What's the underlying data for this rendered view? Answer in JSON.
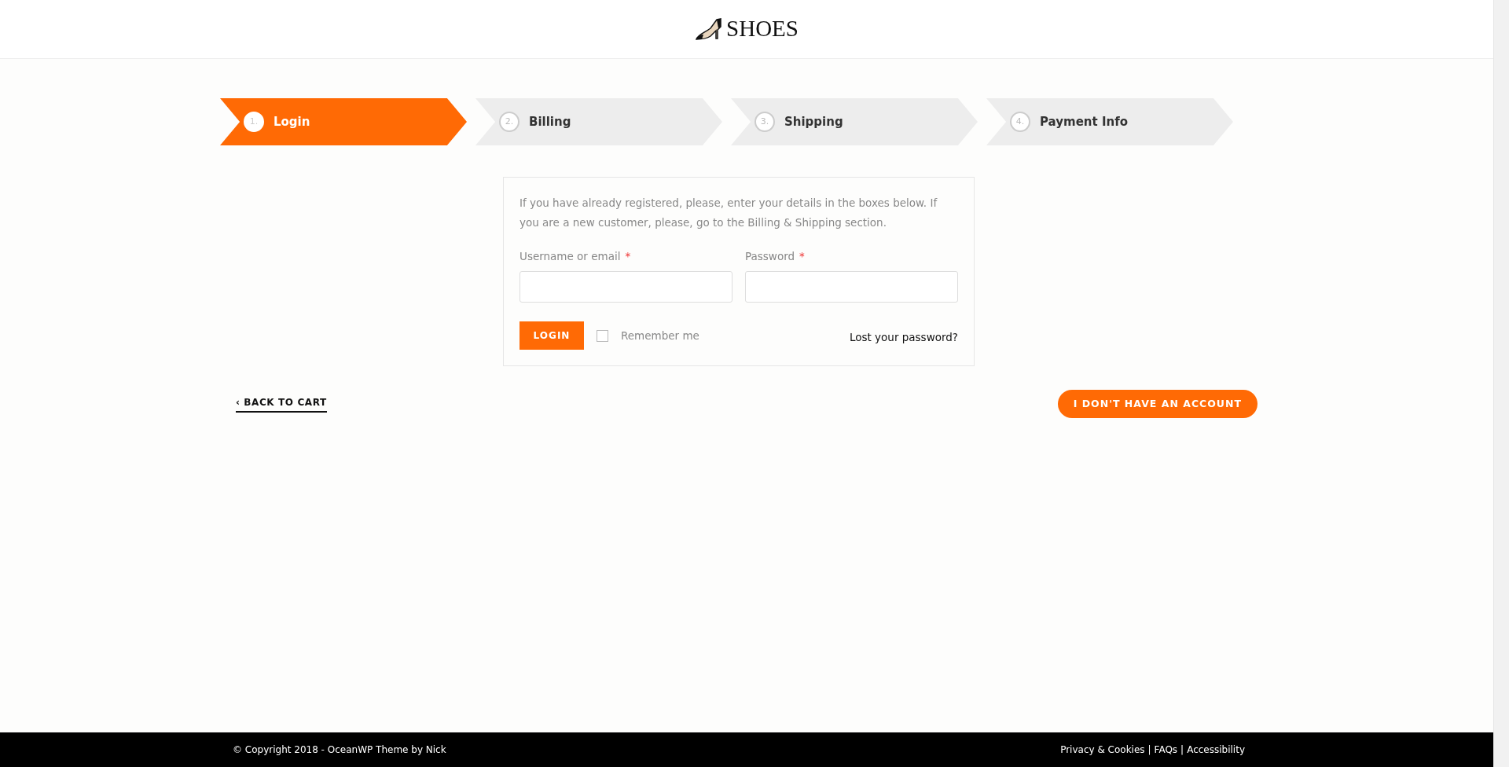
{
  "header": {
    "logo_text": "SHOES"
  },
  "steps": [
    {
      "number": "1.",
      "label": "Login",
      "selected": true
    },
    {
      "number": "2.",
      "label": "Billing",
      "selected": false
    },
    {
      "number": "3.",
      "label": "Shipping",
      "selected": false
    },
    {
      "number": "4.",
      "label": "Payment Info",
      "selected": false
    }
  ],
  "login_form": {
    "intro": "If you have already registered, please, enter your details in the boxes below. If you are a new customer, please, go to the Billing & Shipping section.",
    "fields": [
      {
        "label": "Username or email",
        "required": true
      },
      {
        "label": "Password",
        "required": true
      }
    ],
    "required_mark": "*",
    "login_button": "LOGIN",
    "remember_me": {
      "label": "Remember me",
      "checked": false
    },
    "lost_password": "Lost your password?"
  },
  "nav": {
    "back_link": {
      "arrow": "‹",
      "label": "BACK TO CART"
    },
    "next_button": "I DON'T HAVE AN ACCOUNT"
  },
  "footer": {
    "copyright": "© Copyright 2018 - OceanWP Theme by Nick",
    "links": [
      "Privacy & Cookies",
      "FAQs",
      "Accessibility"
    ],
    "separator": "|"
  }
}
